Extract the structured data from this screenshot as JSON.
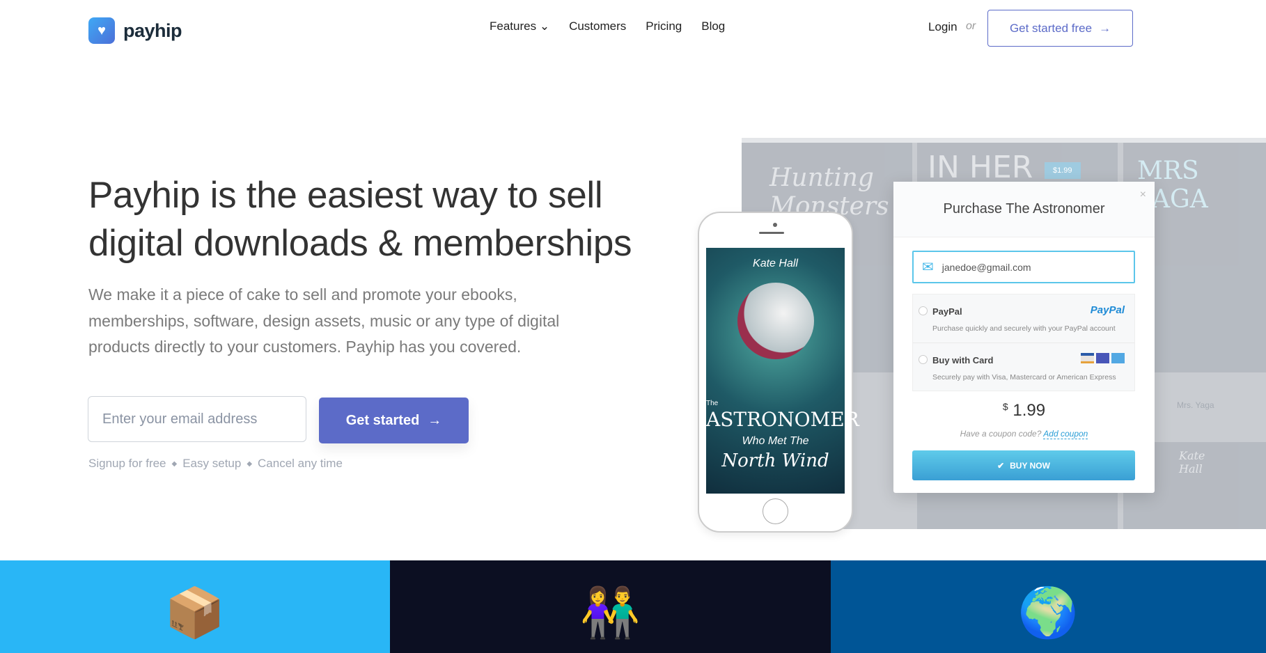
{
  "header": {
    "brand": "payhip",
    "nav": [
      "Features",
      "Customers",
      "Pricing",
      "Blog"
    ],
    "login": "Login",
    "or": "or",
    "cta": "Get started free",
    "arrow": "→"
  },
  "hero": {
    "title": "Payhip is the easiest way to sell digital downloads & memberships",
    "lead": "We make it a piece of cake to sell and promote your ebooks, memberships, software, design assets, music or any type of digital products directly to your customers. Payhip has you covered.",
    "email_placeholder": "Enter your email address",
    "button": "Get started",
    "perks": [
      "Signup for free",
      "Easy setup",
      "Cancel any time"
    ]
  },
  "mockup": {
    "tiles": [
      "Hunting Monsters",
      "IN HER HEAD",
      "MRS YAGA",
      "Mrs. Yaga",
      "Kate Hall"
    ],
    "tile_price": "$1.99",
    "modal": {
      "title": "Purchase The Astronomer",
      "close": "×",
      "email": "janedoe@gmail.com",
      "paypal_label": "PayPal",
      "paypal_logo": "PayPal",
      "paypal_desc": "Purchase quickly and securely with your PayPal account",
      "card_label": "Buy with Card",
      "card_desc": "Securely pay with Visa, Mastercard or American Express",
      "currency": "$",
      "price": "1.99",
      "coupon_q": "Have a coupon code?",
      "coupon_link": "Add coupon",
      "buy": "BUY NOW"
    },
    "phone": {
      "author": "Kate Hall",
      "the": "The",
      "title": "Astronomer",
      "sub": "Who Met The",
      "sub2": "North Wind"
    }
  },
  "colors": {
    "accent": "#5c6bc8",
    "band1": "#29b6f6",
    "band2": "#0c0f22",
    "band3": "#005596"
  }
}
